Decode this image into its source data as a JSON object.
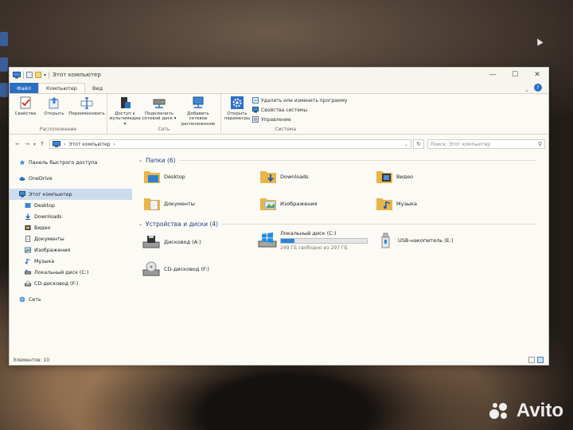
{
  "window": {
    "title": "Этот компьютер",
    "controls": [
      "minimize",
      "maximize",
      "close"
    ]
  },
  "tabs": [
    {
      "label": "Файл"
    },
    {
      "label": "Компьютер"
    },
    {
      "label": "Вид"
    }
  ],
  "ribbon": {
    "groups": [
      {
        "label": "Расположение",
        "buttons": [
          {
            "label": "Свойства",
            "icon": "properties-icon"
          },
          {
            "label": "Открыть",
            "icon": "open-icon"
          },
          {
            "label": "Переименовать",
            "icon": "rename-icon"
          }
        ]
      },
      {
        "label": "Сеть",
        "buttons": [
          {
            "label": "Доступ к мультимедиа ▾",
            "icon": "media-access-icon"
          },
          {
            "label": "Подключить сетевой диск ▾",
            "icon": "network-drive-icon"
          },
          {
            "label": "Добавить сетевое расположение",
            "icon": "network-location-icon"
          }
        ]
      },
      {
        "label": "Система",
        "buttons": [
          {
            "label": "Открыть параметры",
            "icon": "settings-gear-icon"
          }
        ],
        "small": [
          {
            "label": "Удалить или изменить программу",
            "icon": "uninstall-icon"
          },
          {
            "label": "Свойства системы",
            "icon": "system-properties-icon"
          },
          {
            "label": "Управление",
            "icon": "manage-icon"
          }
        ]
      }
    ]
  },
  "address": {
    "path": "Этот компьютер",
    "search_placeholder": "Поиск: Этот компьютер"
  },
  "nav": {
    "quick_access": "Панель быстрого доступа",
    "onedrive": "OneDrive",
    "this_pc": "Этот компьютер",
    "children": [
      "Desktop",
      "Downloads",
      "Видео",
      "Документы",
      "Изображения",
      "Музыка",
      "Локальный диск (C:)",
      "CD-дисковод (F:)"
    ],
    "network": "Сеть"
  },
  "folders_section": {
    "title": "Папки (6)",
    "items": [
      "Desktop",
      "Downloads",
      "Видео",
      "Документы",
      "Изображения",
      "Музыка"
    ]
  },
  "devices_section": {
    "title": "Устройства и диски (4)",
    "drives": [
      {
        "name": "Дисковод (A:)"
      },
      {
        "name": "Локальный диск (C:)",
        "free_text": "249 ГБ свободно из 297 ГБ",
        "used_fraction": 0.16
      },
      {
        "name": "USB-накопитель (E:)"
      },
      {
        "name": "CD-дисковод (F:)"
      }
    ]
  },
  "status": {
    "items": "Элементов: 10"
  },
  "colors": {
    "accent": "#2a6fc4",
    "folder": "#e8b54a",
    "selection": "#ccdcef",
    "progress": "#2a86d6"
  },
  "watermark": "Avito"
}
